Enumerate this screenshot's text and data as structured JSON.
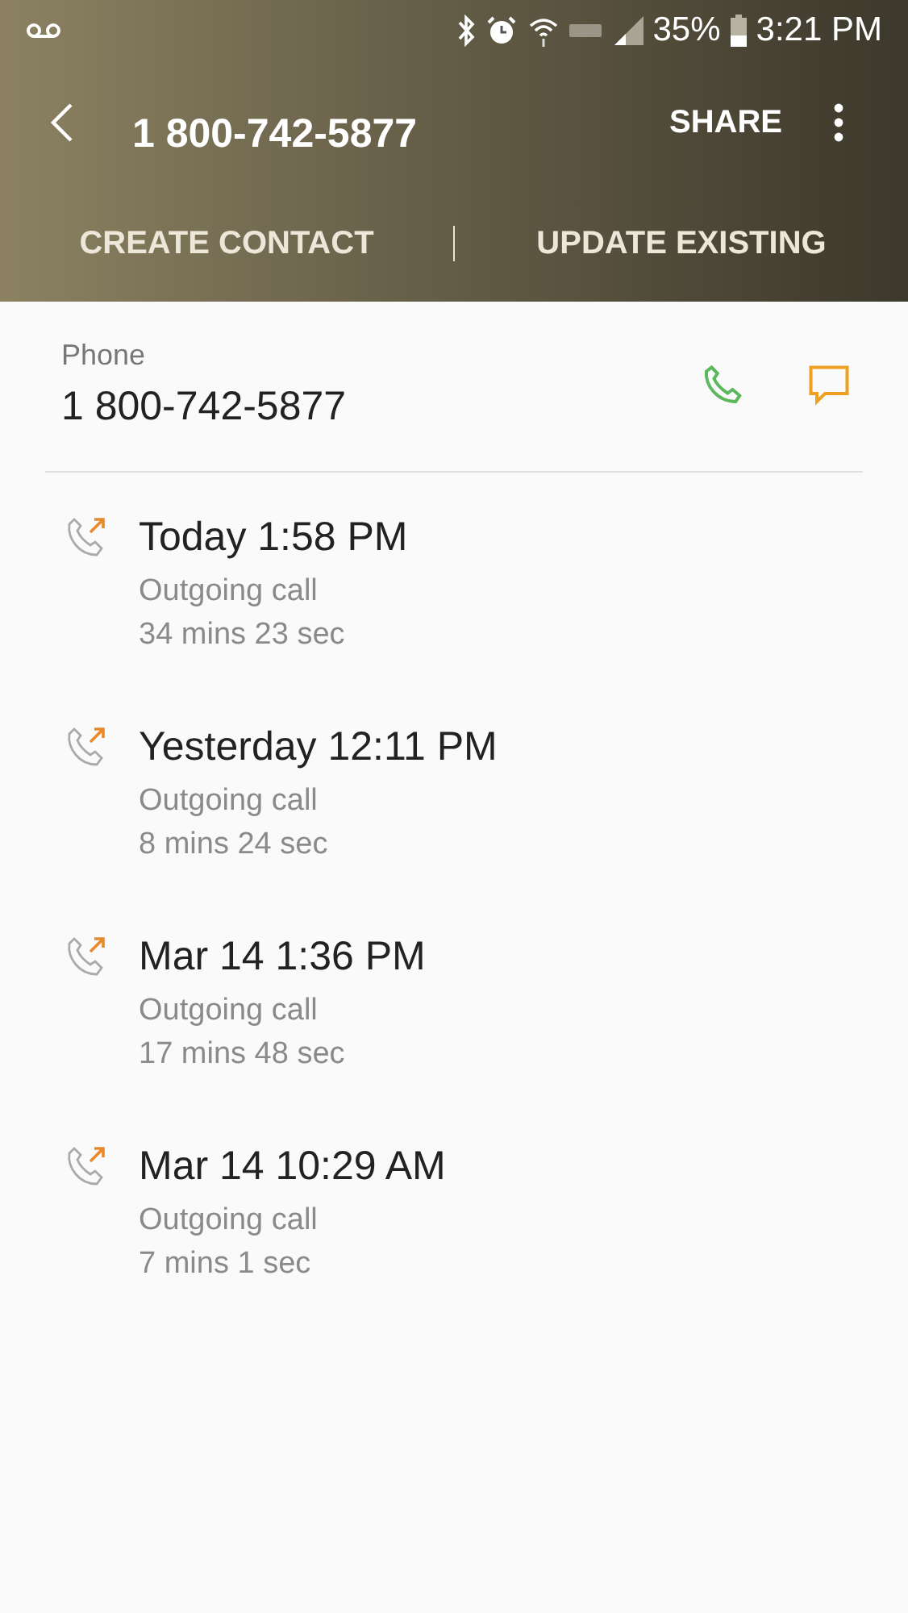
{
  "status_bar": {
    "battery": "35%",
    "time": "3:21 PM"
  },
  "header": {
    "title": "1 800-742-5877",
    "share": "SHARE"
  },
  "actions": [
    "CREATE CONTACT",
    "UPDATE EXISTING"
  ],
  "phone": {
    "label": "Phone",
    "number": "1 800-742-5877"
  },
  "calls": [
    {
      "kind": "outgoing",
      "time": "Today 1:58 PM",
      "type": "Outgoing call",
      "duration": "34 mins 23 sec"
    },
    {
      "kind": "outgoing",
      "time": "Yesterday 12:11 PM",
      "type": "Outgoing call",
      "duration": "8 mins 24 sec"
    },
    {
      "kind": "outgoing",
      "time": "Mar 14 1:36 PM",
      "type": "Outgoing call",
      "duration": "17 mins 48 sec"
    },
    {
      "kind": "outgoing",
      "time": "Mar 14 10:29 AM",
      "type": "Outgoing call",
      "duration": "7 mins 1 sec"
    }
  ]
}
